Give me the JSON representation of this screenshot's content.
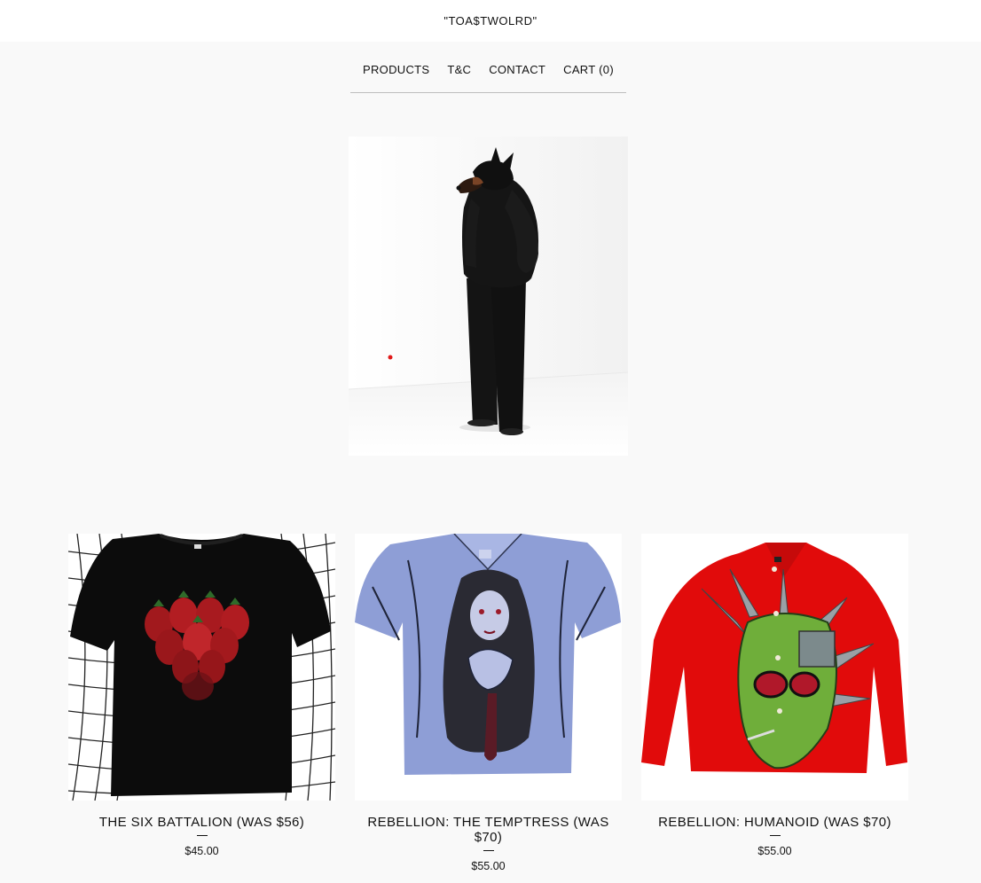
{
  "brand": {
    "name": "\"TOA$TWOLRD\""
  },
  "nav": {
    "items": [
      {
        "label": "PRODUCTS"
      },
      {
        "label": "T&C"
      },
      {
        "label": "CONTACT"
      },
      {
        "label": "CART (0)"
      }
    ]
  },
  "hero": {
    "image": "hooded-figure-photo"
  },
  "products": [
    {
      "title": "THE SIX BATTALION (WAS $56)",
      "price": "$45.00",
      "image": "black-tee-strawberries"
    },
    {
      "title": "REBELLION: THE TEMPTRESS (WAS $70)",
      "price": "$55.00",
      "image": "blue-shirt-illustration"
    },
    {
      "title": "REBELLION: HUMANOID (WAS $70)",
      "price": "$55.00",
      "image": "red-shirt-mask"
    }
  ],
  "colors": {
    "background": "#f9f9f9",
    "header": "#ffffff",
    "text": "#111111",
    "rule": "#bdbdbd"
  }
}
